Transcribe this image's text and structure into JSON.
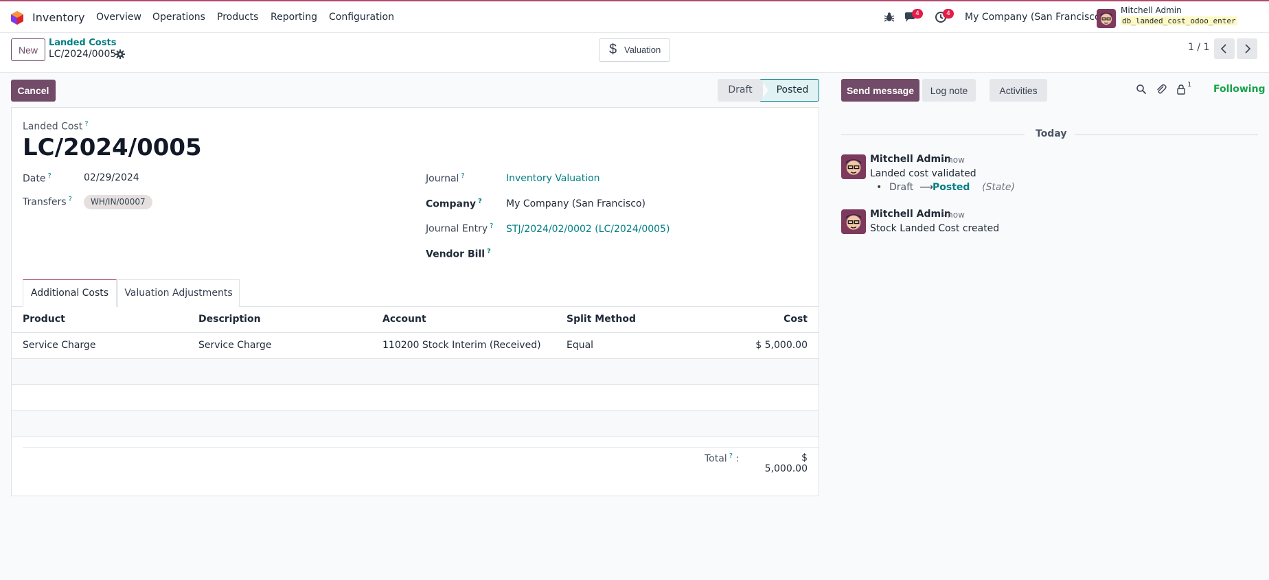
{
  "topbar": {
    "app_name": "Inventory",
    "menu": [
      "Overview",
      "Operations",
      "Products",
      "Reporting",
      "Configuration"
    ],
    "messages_count": "4",
    "activities_count": "4",
    "company": "My Company (San Francisco)",
    "user_name": "Mitchell Admin",
    "db_name": "db_landed_cost_odoo_enter",
    "accent_color": "#b0486e"
  },
  "control": {
    "new_label": "New",
    "breadcrumb_parent": "Landed Costs",
    "breadcrumb_current": "LC/2024/0005",
    "valuation_label": "Valuation",
    "pager": "1 / 1"
  },
  "status": {
    "cancel_label": "Cancel",
    "stages": [
      "Draft",
      "Posted"
    ],
    "current_stage": "Posted"
  },
  "form": {
    "record_label": "Landed Cost",
    "record_name": "LC/2024/0005",
    "date_label": "Date",
    "date_value": "02/29/2024",
    "transfers_label": "Transfers",
    "transfers_value": "WH/IN/00007",
    "journal_label": "Journal",
    "journal_value": "Inventory Valuation",
    "company_label": "Company",
    "company_value": "My Company (San Francisco)",
    "journal_entry_label": "Journal Entry",
    "journal_entry_value": "STJ/2024/02/0002 (LC/2024/0005)",
    "vendor_bill_label": "Vendor Bill",
    "help_mark": "?"
  },
  "tabs": [
    "Additional Costs",
    "Valuation Adjustments"
  ],
  "table": {
    "columns": [
      "Product",
      "Description",
      "Account",
      "Split Method",
      "Cost"
    ],
    "rows": [
      [
        "Service Charge",
        "Service Charge",
        "110200 Stock Interim (Received)",
        "Equal",
        "$ 5,000.00"
      ]
    ],
    "total_label": "Total",
    "total_value": "$ 5,000.00"
  },
  "chatter": {
    "send_label": "Send message",
    "log_label": "Log note",
    "activities_label": "Activities",
    "followers_count": "1",
    "following_label": "Following",
    "date_separator": "Today",
    "messages": [
      {
        "author": "Mitchell Admin",
        "time": "- now",
        "body": "Landed cost validated",
        "track_old": "Draft",
        "track_arrow": "⟶",
        "track_new": "Posted",
        "track_field": "(State)"
      },
      {
        "author": "Mitchell Admin",
        "time": "- now",
        "body": "Stock Landed Cost created"
      }
    ]
  }
}
